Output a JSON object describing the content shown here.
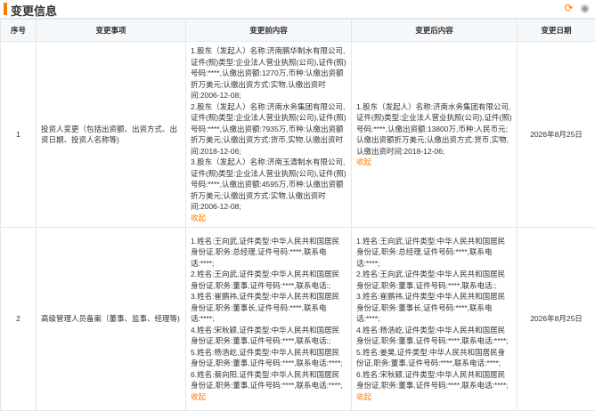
{
  "header": {
    "title": "变更信息",
    "refresh_icon": "refresh-icon",
    "eye_icon": "eye-icon"
  },
  "table": {
    "columns": [
      "序号",
      "变更事项",
      "变更前内容",
      "变更后内容",
      "变更日期"
    ],
    "rows": [
      {
        "index": "1",
        "item": "投资人变更（包括出资额、出资方式、出资日期、投资人名称等)",
        "before": [
          "1.股东（发起人）名称:济南鹏华制水有限公司,证件(照)类型:企业法人营业执照(公司),证件(照)号码:****,认缴出资额:1270万,币种:认缴出资额折万美元;认缴出资方式:实物,认缴出资时间:2006-12-08;",
          "2.股东（发起人）名称:济南水务集团有限公司,证件(照)类型:企业法人营业执照(公司),证件(照)号码:****,认缴出资额:7935万,币种:认缴出资额折万美元;认缴出资方式:货币,实物,认缴出资时间:2018-12-06;",
          "3.股东（发起人）名称:济南玉清制水有限公司,证件(照)类型:企业法人营业执照(公司),证件(照)号码:****,认缴出资额:4595万,币种:认缴出资额折万美元;认缴出资方式:实物,认缴出资时间:2006-12-08;"
        ],
        "after": [
          "1.股东（发起人）名称:济南水务集团有限公司,证件(照)类型:企业法人营业执照(公司),证件(照)号码:****,认缴出资额:13800万,币种:人民币元;认缴出资额折万美元;认缴出资方式:货币,实物,认缴出资时间:2018-12-06;"
        ],
        "date": "2026年8月25日"
      },
      {
        "index": "2",
        "item": "高级管理人员备案（董事、监事、经理等)",
        "before": [
          "1.姓名:王向武,证件类型:中华人民共和国居民身份证,职务:总经理,证件号码:****,联系电话:****;",
          "2.姓名:王向武,证件类型:中华人民共和国居民身份证,职务:董事,证件号码:****,联系电话:;",
          "3.姓名:崔鹏祎,证件类型:中华人民共和国居民身份证,职务:董事长,证件号码:****,联系电话:****;",
          "4.姓名:宋秋颖,证件类型:中华人民共和国居民身份证,职务:董事,证件号码:****,联系电话:;",
          "5.姓名:杨浩屹,证件类型:中华人民共和国居民身份证,职务:董事,证件号码:****,联系电话:****;",
          "6.姓名:蔡向阳,证件类型:中华人民共和国居民身份证,职务:董事,证件号码:****,联系电话:****;"
        ],
        "after": [
          "1.姓名:王向武,证件类型:中华人民共和国居民身份证,职务:总经理,证件号码:****,联系电话:****;",
          "2.姓名:王向武,证件类型:中华人民共和国居民身份证,职务:董事,证件号码:****,联系电话:;",
          "3.姓名:崔鹏祎,证件类型:中华人民共和国居民身份证,职务:董事长,证件号码:****,联系电话:****;",
          "4.姓名:杨浩屹,证件类型:中华人民共和国居民身份证,职务:董事,证件号码:****,联系电话:****;",
          "5.姓名:姜昊,证件类型:中华人民共和国居民身份证,职务:董事,证件号码:****,联系电话:****;",
          "6.姓名:宋秋颖,证件类型:中华人民共和国居民身份证,职务:董事,证件号码:****,联系电话:****;"
        ],
        "date": "2026年8月25日"
      }
    ],
    "collapse_label": "收起"
  }
}
